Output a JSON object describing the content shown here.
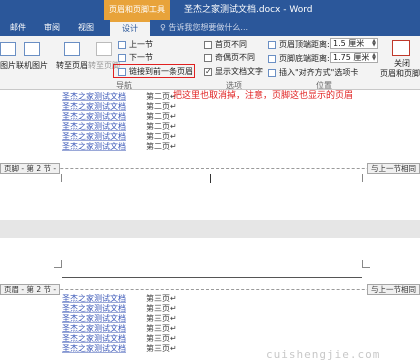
{
  "window": {
    "context_tab_header": "页眉和页脚工具",
    "title": "圣杰之家测试文档.docx - Word"
  },
  "tabs": [
    {
      "label": "邮件"
    },
    {
      "label": "审阅"
    },
    {
      "label": "视图"
    },
    {
      "label": "设计"
    }
  ],
  "tell_me": "♀ 告诉我您想要做什么...",
  "ribbon": {
    "picture": "图片",
    "online_picture": "联机图片",
    "goto_header": "转至页眉",
    "goto_footer": "转至页脚",
    "prev_section": "上一节",
    "next_section": "下一节",
    "link_previous": "链接到前一条页眉",
    "nav_group": "导航",
    "different_first_page": "首页不同",
    "different_odd_even": "奇偶页不同",
    "show_doc_text": "显示文档文字",
    "options_group": "选项",
    "header_from_top_label": "页眉顶端距离:",
    "header_from_top_value": "1.5 厘米",
    "footer_from_bottom_label": "页脚底端距离:",
    "footer_from_bottom_value": "1.75 厘米",
    "insert_alignment_tab": "插入\"对齐方式\"选项卡",
    "position_group": "位置",
    "close_line1": "关闭",
    "close_line2": "页眉和页脚",
    "close_group": "关闭"
  },
  "annotation": "把这里也取消掉，注意，页脚这也显示的页眉",
  "document": {
    "lines_top": [
      {
        "text": "圣杰之家测试文档",
        "page": "第二页↵"
      },
      {
        "text": "圣杰之家测试文档",
        "page": "第二页↵"
      },
      {
        "text": "圣杰之家测试文档",
        "page": "第二页↵"
      },
      {
        "text": "圣杰之家测试文档",
        "page": "第二页↵"
      },
      {
        "text": "圣杰之家测试文档",
        "page": "第二页↵"
      },
      {
        "text": "圣杰之家测试文档",
        "page": "第二页↵"
      }
    ],
    "footer_tag": "页脚 - 第 2 节 -",
    "footer_same_as_prev": "与上一节相同",
    "header_tag": "页眉 - 第 2 节 -",
    "header_same_as_prev": "与上一节相同",
    "lines_bottom": [
      {
        "text": "圣杰之家测试文档",
        "page": "第三页↵"
      },
      {
        "text": "圣杰之家测试文档",
        "page": "第三页↵"
      },
      {
        "text": "圣杰之家测试文档",
        "page": "第三页↵"
      },
      {
        "text": "圣杰之家测试文档",
        "page": "第三页↵"
      },
      {
        "text": "圣杰之家测试文档",
        "page": "第三页↵"
      },
      {
        "text": "圣杰之家测试文档",
        "page": "第三页↵"
      }
    ]
  },
  "watermark": "cuishengjie.com"
}
